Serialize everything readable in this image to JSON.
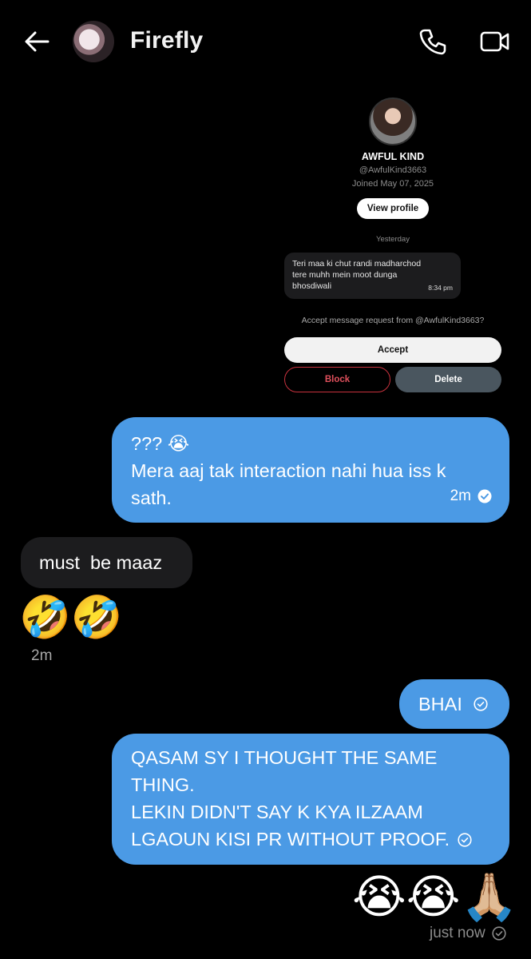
{
  "header": {
    "contact_name": "Firefly"
  },
  "card": {
    "profile_name": "AWFUL KIND",
    "handle": "@AwfulKind3663",
    "joined": "Joined May 07, 2025",
    "view_profile_label": "View profile",
    "date_separator": "Yesterday",
    "message_text": "Teri maa ki chut randi madharchod tere muhh mein moot dunga bhosdiwali",
    "message_time": "8:34 pm",
    "accept_prompt": "Accept message request from @AwfulKind3663?",
    "accept_label": "Accept",
    "block_label": "Block",
    "delete_label": "Delete"
  },
  "messages": {
    "m1_line1": "??? 😭",
    "m1_line2": "Mera aaj tak interaction nahi hua iss k sath.",
    "m1_time": "2m",
    "m2_text": "must  be maaz",
    "emoji_reply": "🤣🤣",
    "emoji_reply_time": "2m",
    "m3_text": "BHAI",
    "m4_text": "QASAM SY I THOUGHT THE SAME THING.\nLEKIN DIDN'T SAY K KYA ILZAAM LGAOUN KISI PR WITHOUT PROOF.",
    "m4_line1": "QASAM SY I THOUGHT THE SAME",
    "m4_line2": "THING.",
    "m4_line3": "LEKIN DIDN'T SAY K KYA ILZAAM",
    "m4_line4": "LGAOUN KISI PR WITHOUT PROOF.",
    "emoji_last": "😭😭🙏🏼",
    "last_time": "just now"
  },
  "icons": {
    "back": "back-arrow-icon",
    "call": "phone-icon",
    "video": "video-camera-icon",
    "read": "read-check-icon"
  },
  "colors": {
    "outgoing_bubble": "#4b9ae5",
    "incoming_bubble": "#1c1c1e",
    "background": "#000000"
  }
}
